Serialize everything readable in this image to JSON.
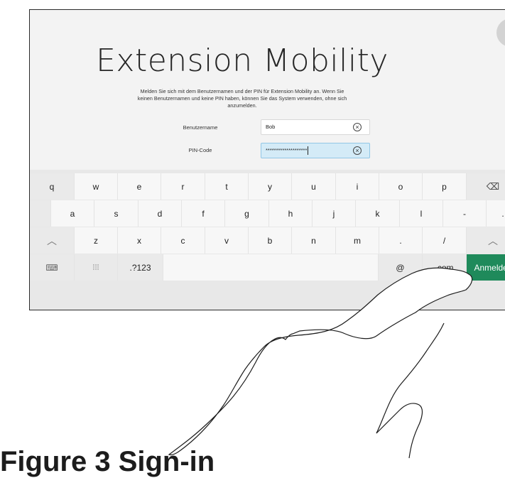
{
  "screen": {
    "title": "Extension Mobility",
    "description": "Melden Sie sich mit dem Benutzernamen und der PIN für Extension Mobility an. Wenn Sie keinen Benutzernamen und keine PIN haben, können Sie das System verwenden, ohne sich anzumelden."
  },
  "form": {
    "username_label": "Benutzername",
    "username_value": "Bob",
    "pin_label": "PIN-Code",
    "pin_value": "********************"
  },
  "keyboard": {
    "row1": [
      "q",
      "w",
      "e",
      "r",
      "t",
      "y",
      "u",
      "i",
      "o",
      "p"
    ],
    "row2": [
      "a",
      "s",
      "d",
      "f",
      "g",
      "h",
      "j",
      "k",
      "l",
      "-",
      "."
    ],
    "row3": [
      "z",
      "x",
      "c",
      "v",
      "b",
      "n",
      "m",
      ".",
      "/"
    ],
    "row4": {
      "numbers_label": ".?123",
      "at_label": "@",
      "dotcom_label": ".com",
      "enter_label": "Anmelden"
    }
  },
  "bottom_caption": "Figure 3 Sign-in"
}
